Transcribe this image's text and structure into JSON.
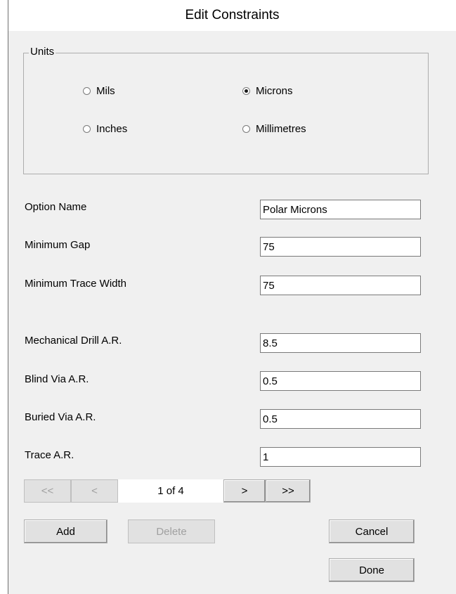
{
  "dialog": {
    "title": "Edit Constraints"
  },
  "units": {
    "group_label": "Units",
    "options": {
      "mils": "Mils",
      "microns": "Microns",
      "inches": "Inches",
      "millimetres": "Millimetres"
    },
    "selected": "Microns"
  },
  "fields": {
    "option_name": {
      "label": "Option Name",
      "value": "Polar Microns"
    },
    "minimum_gap": {
      "label": "Minimum Gap",
      "value": "75"
    },
    "minimum_trace_width": {
      "label": "Minimum Trace Width",
      "value": "75"
    },
    "mechanical_drill_ar": {
      "label": "Mechanical Drill A.R.",
      "value": "8.5"
    },
    "blind_via_ar": {
      "label": "Blind Via A.R.",
      "value": "0.5"
    },
    "buried_via_ar": {
      "label": "Buried Via A.R.",
      "value": "0.5"
    },
    "trace_ar": {
      "label": "Trace A.R.",
      "value": "1"
    }
  },
  "navigation": {
    "first": "<<",
    "previous": "<",
    "page_text": "1 of 4",
    "next": ">",
    "last": ">>"
  },
  "buttons": {
    "add": "Add",
    "delete": "Delete",
    "cancel": "Cancel",
    "done": "Done"
  }
}
